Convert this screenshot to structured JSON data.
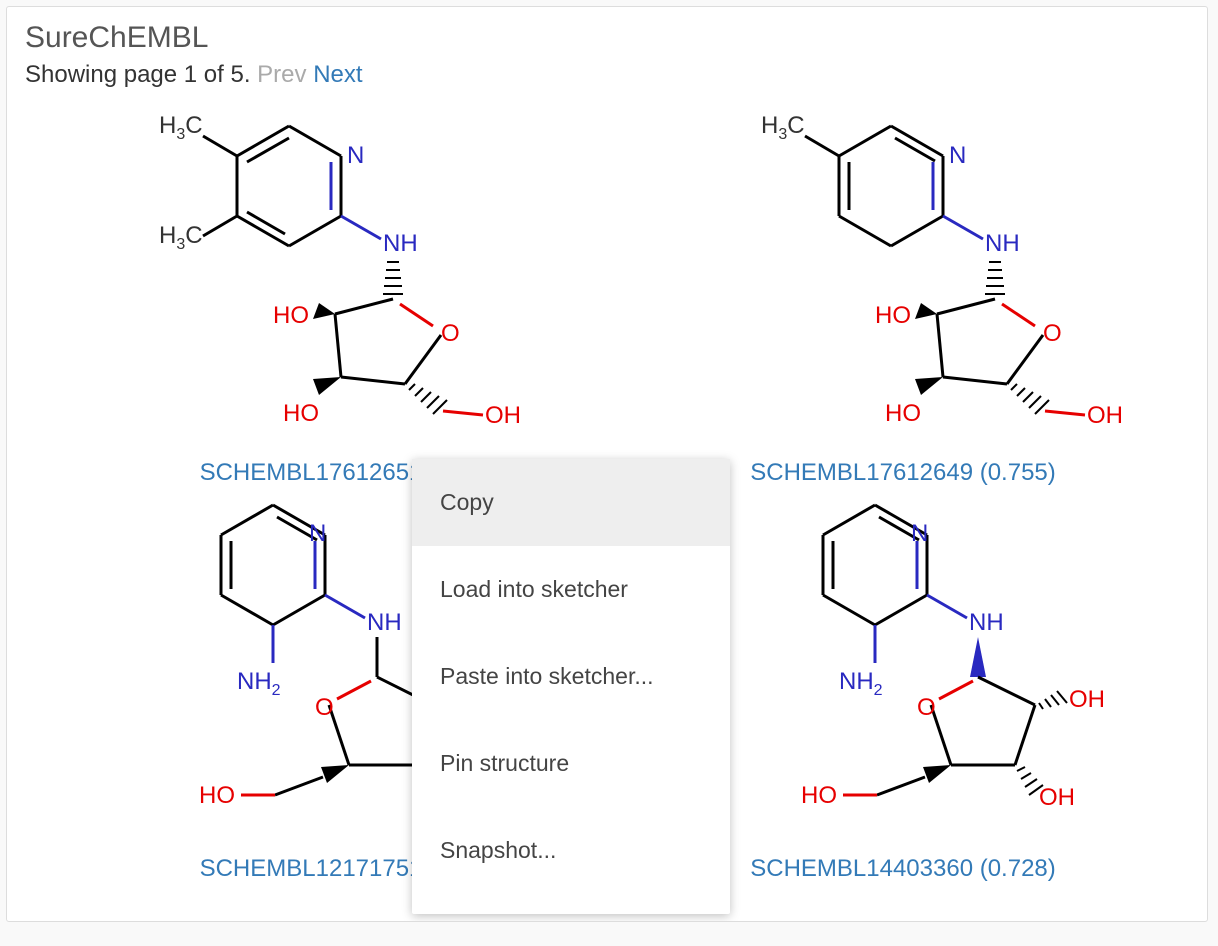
{
  "panel": {
    "title": "SureChEMBL",
    "pager_text": "Showing page 1 of 5. ",
    "prev_label": "Prev",
    "next_label": "Next"
  },
  "compounds": [
    {
      "id": "SCHEMBL17612651",
      "similarity": "",
      "caption": "SCHEMBL17612651 "
    },
    {
      "id": "SCHEMBL17612649",
      "similarity": "0.755",
      "caption": "SCHEMBL17612649 (0.755)"
    },
    {
      "id": "SCHEMBL12171751",
      "similarity": "",
      "caption": "SCHEMBL12171751 "
    },
    {
      "id": "SCHEMBL14403360",
      "similarity": "0.728",
      "caption": "SCHEMBL14403360 (0.728)"
    }
  ],
  "context_menu": {
    "items": [
      {
        "label": "Copy",
        "highlight": true
      },
      {
        "label": "Load into sketcher",
        "highlight": false
      },
      {
        "label": "Paste into sketcher...",
        "highlight": false
      },
      {
        "label": "Pin structure",
        "highlight": false
      },
      {
        "label": "Snapshot...",
        "highlight": false
      }
    ]
  }
}
